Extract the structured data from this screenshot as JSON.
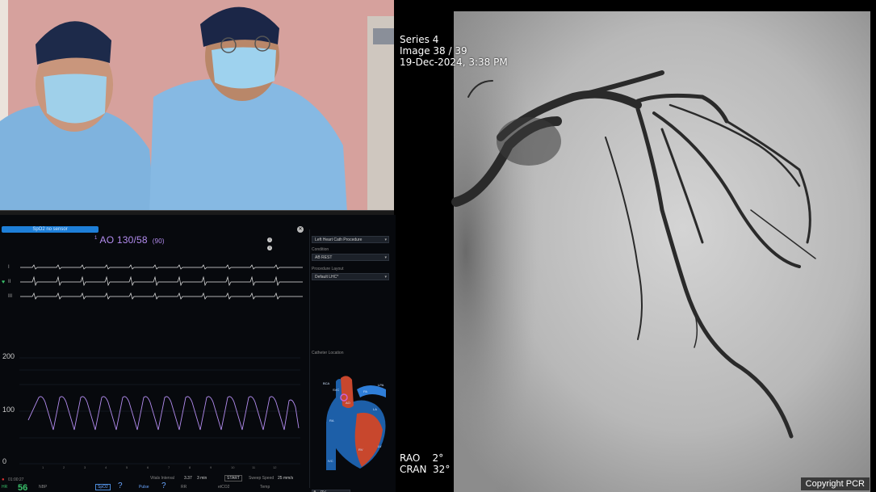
{
  "monitor": {
    "spo2_bar_label": "SpO2 no sensor",
    "bp_superscript": "1",
    "bp_label": "AO 130/58",
    "bp_mean": "(90)",
    "lead_labels": [
      "I",
      "II",
      "III"
    ],
    "pressure_scale": [
      "200",
      "100",
      "0"
    ],
    "x_ticks": [
      "1",
      "2",
      "3",
      "4",
      "5",
      "6",
      "7",
      "8",
      "9",
      "10",
      "11",
      "12"
    ],
    "bottom": {
      "time": "01:00:27",
      "hr_label": "HR",
      "hr_value": "56",
      "nbp": "NBP",
      "spo2": "SpO2",
      "spo2_value": "?",
      "pulse": "Pulse",
      "pulse_value": "?",
      "rr": "RR",
      "etco2": "etCO2",
      "temp": "Temp",
      "vitals_interval": "Vitals Interval",
      "vitals_interval_value": "3.37",
      "vitals_min": "3 min",
      "start": "START",
      "sweep_speed": "Sweep Speed",
      "sweep_value": "25 mm/s"
    }
  },
  "controls": {
    "procedure_value": "Left Heart Cath Procedure",
    "condition_label": "Condition",
    "condition_value": "AB REST",
    "layout_label": "Procedure Layout",
    "layout_value": "Default LHC*",
    "catheter_label": "Catheter Location",
    "pv_value": "PV",
    "heart_labels": [
      "BCA",
      "SVC",
      "AO",
      "PA",
      "LPA",
      "LA",
      "RA",
      "LV",
      "RV",
      "IVC"
    ]
  },
  "angio": {
    "series": "Series 4",
    "image": "Image 38 / 39",
    "date": "19-Dec-2024, 3:38 PM",
    "rao": "RAO    2°",
    "cran": "CRAN  32°",
    "copyright": "Copyright PCR"
  },
  "colors": {
    "spo2_blue": "#1e7fd8",
    "bp_purple": "#b38cf0",
    "ecg_white": "#e8e8e8",
    "hr_green": "#39c06a"
  }
}
